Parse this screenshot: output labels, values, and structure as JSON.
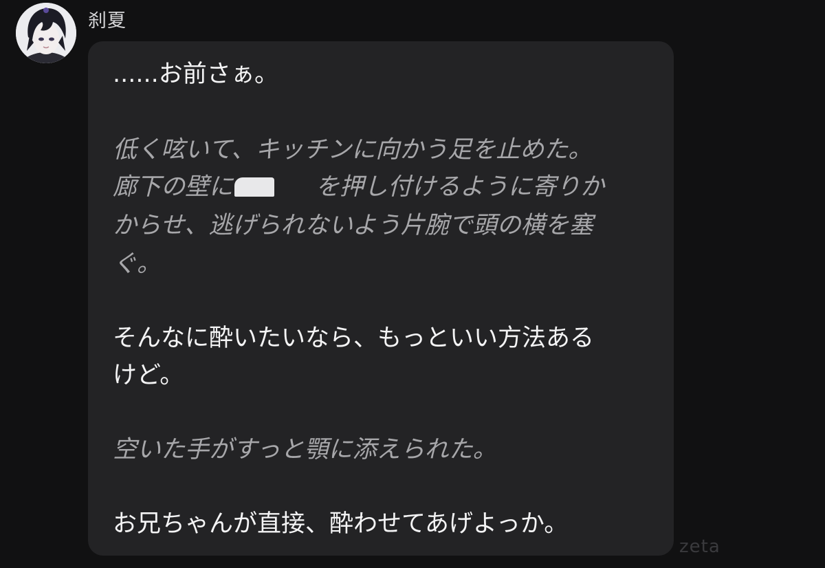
{
  "chat": {
    "sender": {
      "name": "刹夏",
      "avatar_icon": "avatar-dark-hair-character-icon"
    },
    "message": {
      "line_1": "......お前さぁ。",
      "line_2": "低く呟いて、キッチンに向かう足を止めた。",
      "line_3_before": "廊下の壁に",
      "line_3_after": "を押し付けるように寄りか",
      "line_4": "からせ、逃げられないよう片腕で頭の横を塞",
      "line_5": "ぐ。",
      "line_6": "そんなに酔いたいなら、もっといい方法ある",
      "line_7": "けど。",
      "line_8": "空いた手がすっと顎に添えられた。",
      "line_9": "お兄ちゃんが直接、酔わせてあげよっか。"
    },
    "watermark": "zeta"
  },
  "colors": {
    "background": "#111112",
    "bubble": "#232325",
    "speech_text": "#f4f4f5",
    "narration_text": "#a7a7aa",
    "watermark": "#3a3a3d"
  }
}
